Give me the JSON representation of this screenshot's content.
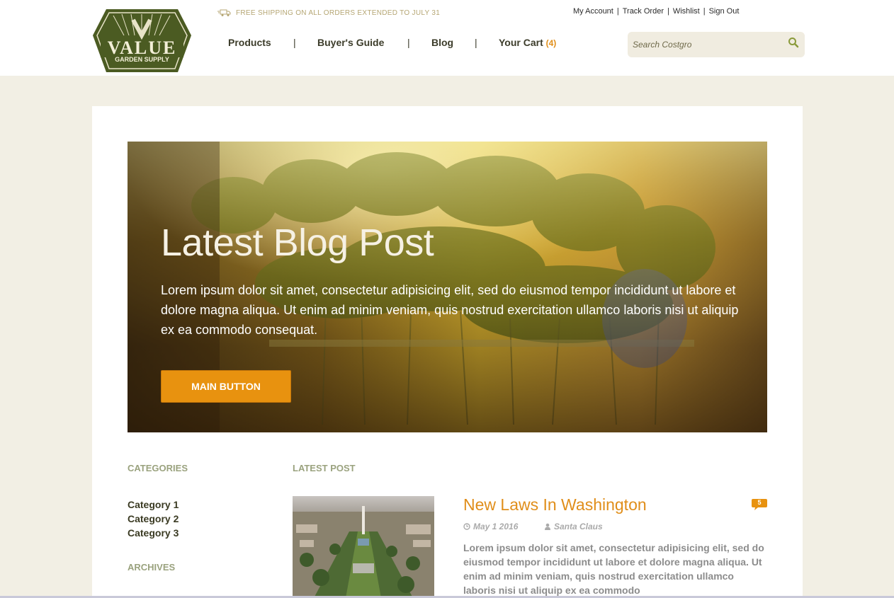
{
  "header": {
    "logo": {
      "main": "VALUE",
      "sub": "GARDEN SUPPLY"
    },
    "shipping_text": "FREE SHIPPING ON ALL ORDERS EXTENDED TO JULY 31",
    "account_links": [
      "My Account",
      "Track Order",
      "Wishlist",
      "Sign Out"
    ],
    "nav": {
      "products": "Products",
      "buyers_guide": "Buyer's Guide",
      "blog": "Blog",
      "cart": "Your Cart",
      "cart_count": "(4)",
      "separator": "|"
    },
    "search": {
      "placeholder": "Search Costgro"
    }
  },
  "hero": {
    "title": "Latest Blog Post",
    "text": "Lorem ipsum dolor sit amet, consectetur adipisicing elit, sed do eiusmod tempor incididunt ut labore et dolore magna aliqua. Ut enim ad minim veniam, quis nostrud exercitation ullamco laboris nisi ut aliquip ex ea commodo consequat.",
    "button": "MAIN BUTTON"
  },
  "sidebar": {
    "categories_heading": "CATEGORIES",
    "categories": [
      "Category 1",
      "Category 2",
      "Category 3"
    ],
    "archives_heading": "ARCHIVES"
  },
  "post": {
    "heading": "LATEST POST",
    "title": "New Laws In Washington",
    "comments": "5",
    "date": "May 1 2016",
    "author": "Santa Claus",
    "excerpt": "Lorem ipsum dolor sit amet, consectetur adipisicing elit, sed do eiusmod tempor incididunt ut labore et dolore magna aliqua. Ut enim ad minim veniam, quis nostrud exercitation ullamco laboris nisi ut aliquip ex ea commodo"
  },
  "colors": {
    "accent": "#e8920f",
    "brand_green": "#4a5a22",
    "muted_heading": "#9aa27e",
    "page_bg": "#f2efe4"
  }
}
